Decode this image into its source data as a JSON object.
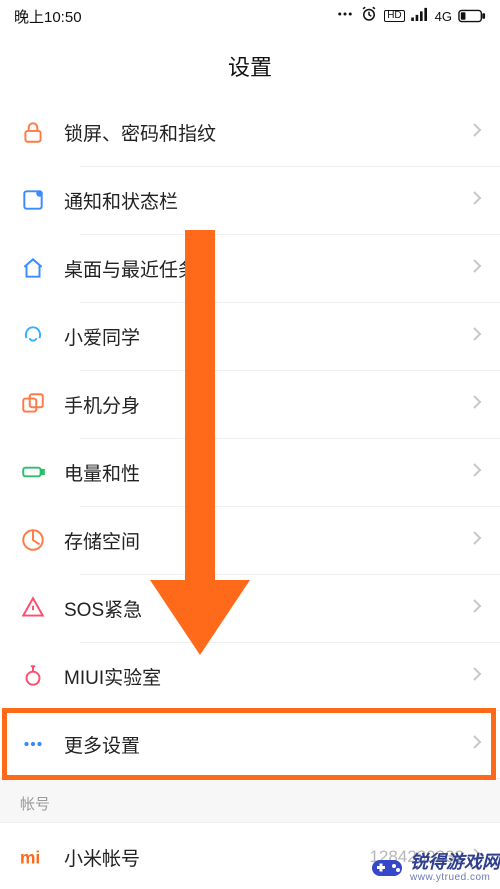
{
  "status": {
    "time": "晚上10:50",
    "network": "4G",
    "hd": "HD"
  },
  "title": "设置",
  "rows": [
    {
      "key": "lock",
      "label": "锁屏、密码和指纹"
    },
    {
      "key": "notif",
      "label": "通知和状态栏"
    },
    {
      "key": "home",
      "label": "桌面与最近任务"
    },
    {
      "key": "xiaoai",
      "label": "小爱同学"
    },
    {
      "key": "dual",
      "label": "手机分身"
    },
    {
      "key": "battery",
      "label": "电量和性"
    },
    {
      "key": "storage",
      "label": "存储空间"
    },
    {
      "key": "sos",
      "label": "SOS紧急"
    },
    {
      "key": "lab",
      "label": "MIUI实验室"
    },
    {
      "key": "more",
      "label": "更多设置"
    }
  ],
  "section_account": "帐号",
  "account_row": {
    "label": "小米帐号",
    "value": "1284239332"
  },
  "watermark": {
    "brand": "锐得游戏网",
    "url": "www.ytrued.com"
  },
  "highlight_index": 9
}
